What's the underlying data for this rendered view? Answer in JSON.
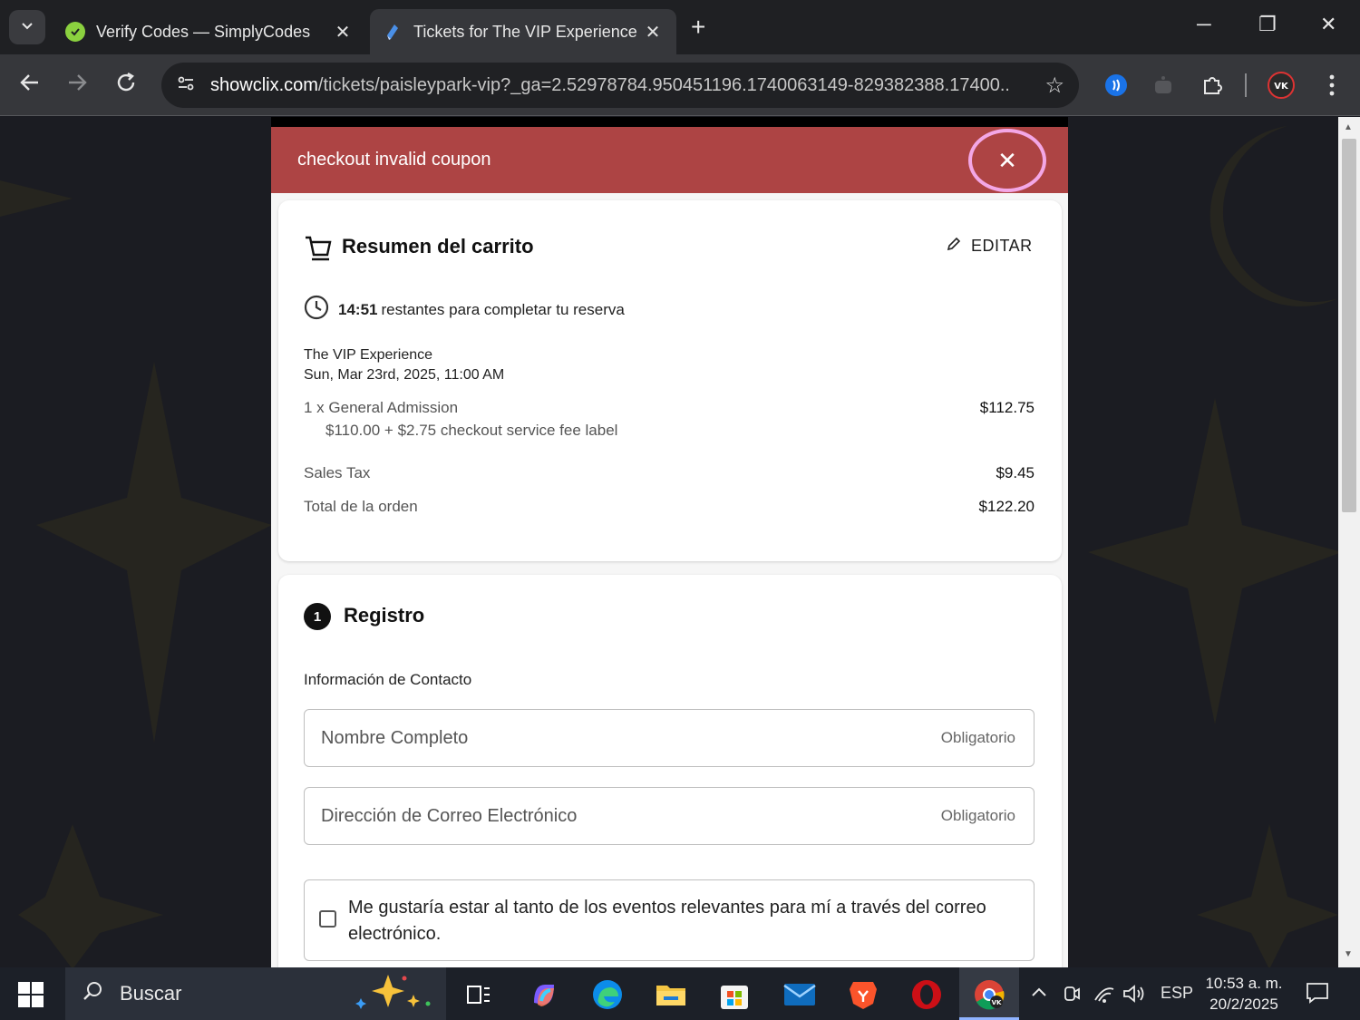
{
  "browser": {
    "tabs": [
      {
        "title": "Verify Codes — SimplyCodes",
        "active": false
      },
      {
        "title": "Tickets for The VIP Experience in",
        "active": true
      }
    ],
    "new_tab": "+",
    "window": {
      "minimize": "─",
      "restore": "❐",
      "close": "✕"
    },
    "url_host": "showclix.com",
    "url_path": "/tickets/paisleypark-vip?_ga=2.52978784.950451196.1740063149-829382388.17400..."
  },
  "alert": {
    "message": "checkout invalid coupon",
    "close": "✕",
    "color": "#ad4444"
  },
  "cart": {
    "title": "Resumen del carrito",
    "edit_label": "EDITAR",
    "timer_value": "14:51",
    "timer_text": "restantes para completar tu reserva",
    "event_name": "The VIP Experience",
    "event_date": "Sun, Mar 23rd, 2025, 11:00 AM",
    "line_item": "1 x General Admission",
    "line_price": "$112.75",
    "fee_label": "$110.00 + $2.75 checkout service fee label",
    "tax_label": "Sales Tax",
    "tax_value": "$9.45",
    "total_label": "Total de la orden",
    "total_value": "$122.20"
  },
  "registration": {
    "step": "1",
    "title": "Registro",
    "section_label": "Información de Contacto",
    "name_placeholder": "Nombre Completo",
    "email_placeholder": "Dirección de Correo Electrónico",
    "required_label": "Obligatorio",
    "opt_in_label": "Me gustaría estar al tanto de los eventos relevantes para mí a través del correo electrónico."
  },
  "taskbar": {
    "search_label": "Buscar",
    "language": "ESP",
    "time": "10:53 a. m.",
    "date": "20/2/2025"
  }
}
